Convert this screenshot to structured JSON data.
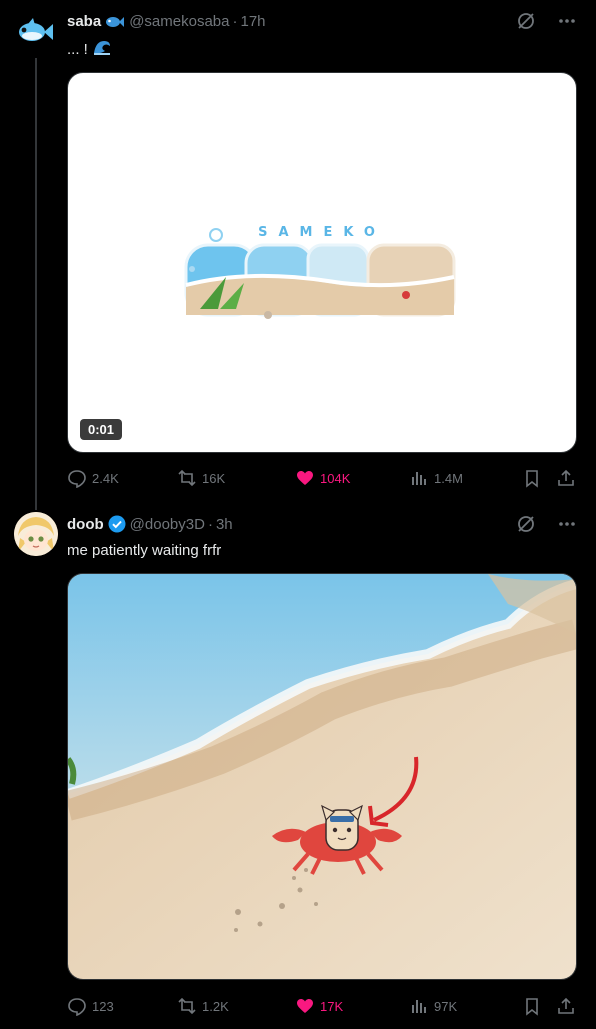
{
  "tweets": [
    {
      "name": "saba",
      "handle": "@samekosaba",
      "separator": "·",
      "time": "17h",
      "text": "... !",
      "media": {
        "type": "video",
        "duration": "0:01",
        "logo_text_small": "SAMEKO",
        "logo_text_big": "SABA"
      },
      "stats": {
        "replies": "2.4K",
        "reposts": "16K",
        "likes": "104K",
        "views": "1.4M"
      }
    },
    {
      "name": "doob",
      "handle": "@dooby3D",
      "separator": "·",
      "time": "3h",
      "text": "me patiently waiting frfr",
      "media": {
        "type": "image"
      },
      "stats": {
        "replies": "123",
        "reposts": "1.2K",
        "likes": "17K",
        "views": "97K"
      }
    }
  ],
  "colors": {
    "like": "#f91880",
    "verified": "#1d9bf0",
    "muted": "#71767b"
  }
}
